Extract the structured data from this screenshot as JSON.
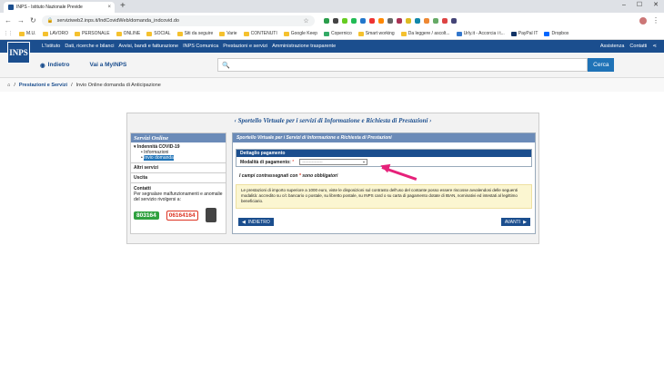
{
  "browser": {
    "tab_title": "INPS - Istituto Nazionale Previde",
    "url": "serviziweb2.inps.it/IndCovidWeb/domanda_indcovid.do",
    "bookmarks": [
      "M.U.",
      "LAVORO",
      "PERSONALE",
      "ONLINE",
      "SOCIAL",
      "Siti da seguire",
      "Varie",
      "CONTENUTI",
      "Google Keep",
      "Copernico",
      "Smart working",
      "Da leggere / ascolt...",
      "Urly.it - Accorcia i t...",
      "PayPal IT",
      "Dropbox"
    ]
  },
  "inps": {
    "logo": "INPS",
    "menu": [
      "L'Istituto",
      "Dati, ricerche e bilanci",
      "Avvisi, bandi e fatturazione",
      "INPS Comunica",
      "Prestazioni e servizi",
      "Amministrazione trasparente"
    ],
    "menu_right": [
      "Assistenza",
      "Contatti"
    ],
    "back_label": "Indietro",
    "vai_label": "Vai a MyINPS",
    "search_btn": "Cerca",
    "breadcrumb": [
      "Prestazioni e Servizi",
      "Invio Online domanda di Anticipazione"
    ]
  },
  "page": {
    "banner": "Sportello Virtuale per i servizi di Informazione e Richiesta di Prestazioni",
    "sidebar_title": "Servizi Online",
    "sidebar_section": "Indennità COVID-19",
    "sidebar_links": [
      "Informazioni",
      "Invio domanda"
    ],
    "altri_servizi": "Altri servizi",
    "uscita": "Uscita",
    "contatti_title": "Contatti",
    "contatti_text": "Per segnalare malfunzionamenti e anomalie del servizio rivolgersi a:",
    "phone_green": "803164",
    "phone_red": "06164164",
    "content_header": "Sportello Virtuale per i Servizi di Informazione e Richiesta di Prestazioni",
    "detail_header": "Dettaglio pagamento",
    "payment_label": "Modalità di pagamento:",
    "payment_value": "---------------",
    "required_note_a": "I campi contrassegnati con",
    "required_note_b": "sono obbligatori",
    "info_text": "Le prestazioni di importo superiore a 1000 euro, viste le disposizioni sul contrasto dell'uso del contante posso essere riscosse avvalendosi delle seguenti modalità: accredito su c/c bancario o postale, su libretto postale, su INPS card o su carta di pagamento dotate di IBAN, nominativi ed intestati al legittimo beneficiario.",
    "btn_back": "INDIETRO",
    "btn_next": "AVANTI"
  }
}
